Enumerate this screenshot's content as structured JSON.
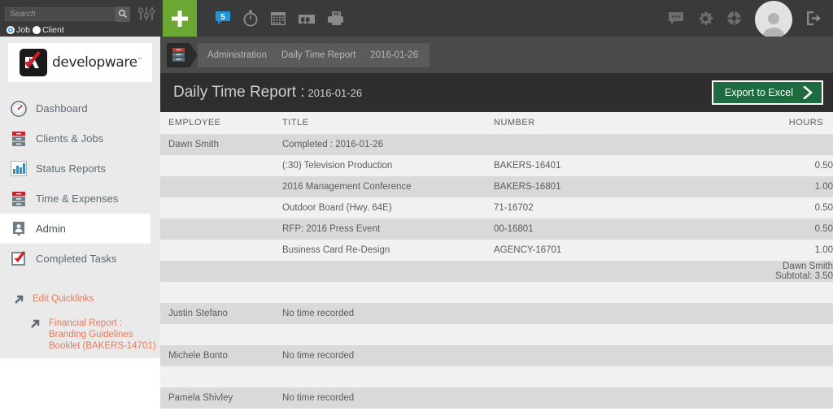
{
  "topbar": {
    "search": {
      "placeholder": "Search",
      "value": "",
      "icon": "search-icon"
    },
    "filter_icon": "sliders-icon",
    "radios": [
      {
        "label": "Job",
        "selected": true
      },
      {
        "label": "Client",
        "selected": false
      }
    ],
    "add_icon": "plus-icon",
    "message_badge": "5",
    "icons": [
      "message-bubble-icon",
      "stopwatch-icon",
      "calendar-icon",
      "filing-cabinet-icon",
      "printer-icon"
    ],
    "right_icons": [
      "chat-icon",
      "gear-icon",
      "globe-icon",
      "avatar-icon",
      "logout-icon"
    ]
  },
  "sidebar": {
    "logo": {
      "text": "developware",
      "tm": "™",
      "mark_icon": "check-logo-icon"
    },
    "items": [
      {
        "label": "Dashboard",
        "icon": "gauge-icon",
        "active": false
      },
      {
        "label": "Clients & Jobs",
        "icon": "drawers-icon",
        "active": false
      },
      {
        "label": "Status Reports",
        "icon": "bar-chart-icon",
        "active": false
      },
      {
        "label": "Time & Expenses",
        "icon": "drawers-icon",
        "active": false
      },
      {
        "label": "Admin",
        "icon": "person-badge-icon",
        "active": true
      },
      {
        "label": "Completed Tasks",
        "icon": "checkbox-icon",
        "active": false
      }
    ],
    "quicklinks": [
      {
        "label": "Edit Quicklinks",
        "icon": "arrow-up-right-icon",
        "sub": false
      },
      {
        "label": "Financial Report : Branding Guidelines Booklet (BAKERS-14701)",
        "icon": "arrow-up-right-icon",
        "sub": true
      }
    ]
  },
  "breadcrumb": {
    "icon": "drawers-icon",
    "items": [
      "Administration",
      "Daily Time Report",
      "2016-01-26"
    ]
  },
  "report": {
    "title": "Daily Time Report :",
    "date": "2016-01-26",
    "export_label": "Export to Excel",
    "export_chevron": "chevron-right-icon",
    "columns": [
      "EMPLOYEE",
      "TITLE",
      "NUMBER",
      "HOURS"
    ],
    "rows": [
      {
        "type": "employee-header",
        "employee": "Dawn Smith",
        "title": "Completed : 2016-01-26",
        "number": "",
        "hours": "",
        "shade": "shade"
      },
      {
        "type": "entry",
        "employee": "",
        "title": "(:30) Television Production",
        "number": "BAKERS-16401",
        "hours": "0.50",
        "shade": "light"
      },
      {
        "type": "entry",
        "employee": "",
        "title": "2016 Management Conference",
        "number": "BAKERS-16801",
        "hours": "1.00",
        "shade": "shade"
      },
      {
        "type": "entry",
        "employee": "",
        "title": "Outdoor Board (Hwy. 64E)",
        "number": "71-16702",
        "hours": "0.50",
        "shade": "light"
      },
      {
        "type": "entry",
        "employee": "",
        "title": "RFP: 2016 Press Event",
        "number": "00-16801",
        "hours": "0.50",
        "shade": "shade"
      },
      {
        "type": "entry",
        "employee": "",
        "title": "Business Card Re-Design",
        "number": "AGENCY-16701",
        "hours": "1.00",
        "shade": "light"
      },
      {
        "type": "subtotal",
        "employee": "",
        "title": "",
        "number": "",
        "hours": "Dawn Smith Subtotal: 3.50",
        "shade": "shade"
      },
      {
        "type": "spacer",
        "employee": "",
        "title": "",
        "number": "",
        "hours": "",
        "shade": "light"
      },
      {
        "type": "employee-header",
        "employee": "Justin Stefano",
        "title": "No time recorded",
        "number": "",
        "hours": "",
        "shade": "shade"
      },
      {
        "type": "spacer",
        "employee": "",
        "title": "",
        "number": "",
        "hours": "",
        "shade": "light"
      },
      {
        "type": "employee-header",
        "employee": "Michele Bonto",
        "title": "No time recorded",
        "number": "",
        "hours": "",
        "shade": "shade"
      },
      {
        "type": "spacer",
        "employee": "",
        "title": "",
        "number": "",
        "hours": "",
        "shade": "light"
      },
      {
        "type": "employee-header",
        "employee": "Pamela Shivley",
        "title": "No time recorded",
        "number": "",
        "hours": "",
        "shade": "shade"
      }
    ]
  },
  "colors": {
    "topbar": "#3a3a3a",
    "accent_green": "#6aa833",
    "export_green": "#1f6b40",
    "link_orange": "#e8795f",
    "sidebar_bg": "#eaeaea",
    "row_shade": "#d9d9d9",
    "row_light": "#f1f1f1",
    "badge_blue": "#2196d6"
  }
}
